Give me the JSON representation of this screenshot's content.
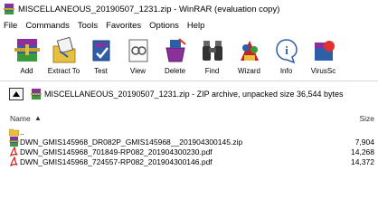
{
  "window": {
    "title": "MISCELLANEOUS_20190507_1231.zip - WinRAR (evaluation copy)"
  },
  "menu": [
    "File",
    "Commands",
    "Tools",
    "Favorites",
    "Options",
    "Help"
  ],
  "toolbar": [
    {
      "label": "Add",
      "icon": "add-icon"
    },
    {
      "label": "Extract To",
      "icon": "extract-to-icon"
    },
    {
      "label": "Test",
      "icon": "test-icon"
    },
    {
      "label": "View",
      "icon": "view-icon"
    },
    {
      "label": "Delete",
      "icon": "delete-icon"
    },
    {
      "label": "Find",
      "icon": "find-icon"
    },
    {
      "label": "Wizard",
      "icon": "wizard-icon"
    },
    {
      "label": "Info",
      "icon": "info-icon"
    },
    {
      "label": "VirusSc",
      "icon": "virus-scan-icon"
    }
  ],
  "pathbar": {
    "text": "MISCELLANEOUS_20190507_1231.zip - ZIP archive, unpacked size 36,544 bytes"
  },
  "columns": {
    "name": "Name",
    "size": "Size"
  },
  "files": [
    {
      "name": "..",
      "size": "",
      "type": "folder-up"
    },
    {
      "name": "DWN_GMIS145968_DR082P_GMIS145968__201904300145.zip",
      "size": "7,904",
      "type": "zip"
    },
    {
      "name": "DWN_GMIS145968_701849-RP082_201904300230.pdf",
      "size": "14,268",
      "type": "pdf"
    },
    {
      "name": "DWN_GMIS145968_724557-RP082_201904300146.pdf",
      "size": "14,372",
      "type": "pdf"
    }
  ],
  "colors": {
    "pdf_red": "#c8201e",
    "folder_yellow": "#e8c040",
    "winrar_purple": "#7b2d8e"
  }
}
